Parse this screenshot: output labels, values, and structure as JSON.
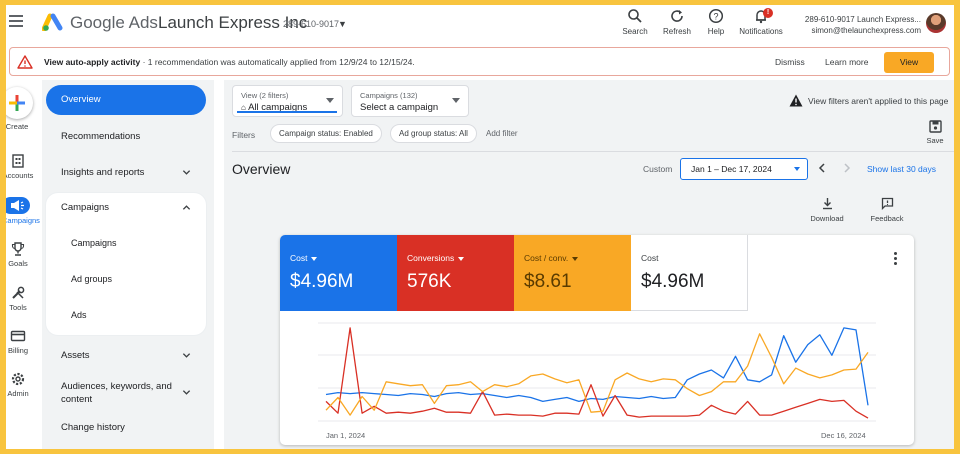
{
  "header": {
    "product": "Google Ads",
    "account_name": "Launch Express Inc",
    "account_id": "289-610-9017",
    "actions": [
      {
        "label": "Search",
        "icon": "search-icon"
      },
      {
        "label": "Refresh",
        "icon": "refresh-icon"
      },
      {
        "label": "Help",
        "icon": "help-icon"
      },
      {
        "label": "Notifications",
        "icon": "bell-icon",
        "badge": "!"
      }
    ],
    "user": {
      "line1": "289-610-9017 Launch Express...",
      "line2": "simon@thelaunchexpress.com"
    }
  },
  "banner": {
    "title": "View auto-apply activity",
    "message": " · 1 recommendation was automatically applied from 12/9/24 to 12/15/24.",
    "dismiss": "Dismiss",
    "learn_more": "Learn more",
    "view": "View"
  },
  "rail": {
    "create": "Create",
    "items": [
      {
        "label": "Accounts",
        "icon": "accounts-icon"
      },
      {
        "label": "Campaigns",
        "icon": "megaphone-icon"
      },
      {
        "label": "Goals",
        "icon": "trophy-icon"
      },
      {
        "label": "Tools",
        "icon": "tools-icon"
      },
      {
        "label": "Billing",
        "icon": "credit-card-icon"
      },
      {
        "label": "Admin",
        "icon": "gear-icon"
      }
    ]
  },
  "nav": {
    "overview": "Overview",
    "recommendations": "Recommendations",
    "insights": "Insights and reports",
    "campaigns": "Campaigns",
    "sub": [
      "Campaigns",
      "Ad groups",
      "Ads"
    ],
    "assets": "Assets",
    "audiences": "Audiences, keywords, and content",
    "change_history": "Change history"
  },
  "toolbar": {
    "view_label": "View (2 filters)",
    "view_value": "All campaigns",
    "campaigns_label": "Campaigns (132)",
    "campaigns_value": "Select a campaign",
    "filters_label": "Filters",
    "chips": [
      "Campaign status: Enabled",
      "Ad group status: All"
    ],
    "add_filter": "Add filter",
    "note": "View filters aren't applied to this page",
    "save": "Save"
  },
  "overview": {
    "title": "Overview",
    "custom": "Custom",
    "date_range": "Jan 1 – Dec 17, 2024",
    "show_last": "Show last 30 days",
    "download": "Download",
    "feedback": "Feedback"
  },
  "metrics": [
    {
      "name": "Cost",
      "value": "$4.96M"
    },
    {
      "name": "Conversions",
      "value": "576K"
    },
    {
      "name": "Cost / conv.",
      "value": "$8.61"
    },
    {
      "name": "Cost",
      "value": "$4.96M"
    }
  ],
  "colors": {
    "blue": "#1a73e8",
    "red": "#d93025",
    "orange": "#f9a825",
    "accent": "#1a73e8"
  },
  "chart_data": {
    "type": "line",
    "x_start": "Jan 1, 2024",
    "x_end": "Dec 16, 2024",
    "series": [
      {
        "name": "Cost",
        "color": "#1a73e8",
        "values": [
          0.27,
          0.29,
          0.28,
          0.29,
          0.28,
          0.27,
          0.26,
          0.28,
          0.27,
          0.25,
          0.28,
          0.29,
          0.27,
          0.28,
          0.26,
          0.24,
          0.26,
          0.24,
          0.2,
          0.22,
          0.24,
          0.2,
          0.23,
          0.22,
          0.25,
          0.24,
          0.23,
          0.25,
          0.23,
          0.24,
          0.42,
          0.48,
          0.52,
          0.44,
          0.66,
          0.42,
          0.4,
          0.47,
          0.87,
          0.6,
          0.78,
          0.88,
          0.67,
          0.95,
          0.93,
          0.16
        ]
      },
      {
        "name": "Conversions",
        "color": "#d93025",
        "values": [
          0.2,
          0.08,
          0.95,
          0.08,
          0.15,
          0.08,
          0.09,
          0.08,
          0.1,
          0.13,
          0.09,
          0.09,
          0.08,
          0.3,
          0.06,
          0.07,
          0.06,
          0.06,
          0.05,
          0.08,
          0.08,
          0.07,
          0.37,
          0.05,
          0.26,
          0.06,
          0.04,
          0.05,
          0.05,
          0.05,
          0.05,
          0.06,
          0.16,
          0.1,
          0.07,
          0.2,
          0.06,
          0.06,
          0.1,
          0.14,
          0.18,
          0.22,
          0.2,
          0.21,
          0.1,
          0.03
        ]
      },
      {
        "name": "Cost / conv.",
        "color": "#f9a825",
        "values": [
          0.11,
          0.24,
          0.06,
          0.25,
          0.11,
          0.4,
          0.38,
          0.36,
          0.37,
          0.18,
          0.36,
          0.37,
          0.4,
          0.3,
          0.37,
          0.35,
          0.38,
          0.46,
          0.48,
          0.43,
          0.39,
          0.42,
          0.09,
          0.1,
          0.42,
          0.49,
          0.43,
          0.4,
          0.43,
          0.42,
          0.33,
          0.26,
          0.3,
          0.4,
          0.4,
          0.56,
          0.89,
          0.65,
          0.38,
          0.54,
          0.48,
          0.44,
          0.47,
          0.52,
          0.53,
          0.7
        ]
      }
    ]
  }
}
